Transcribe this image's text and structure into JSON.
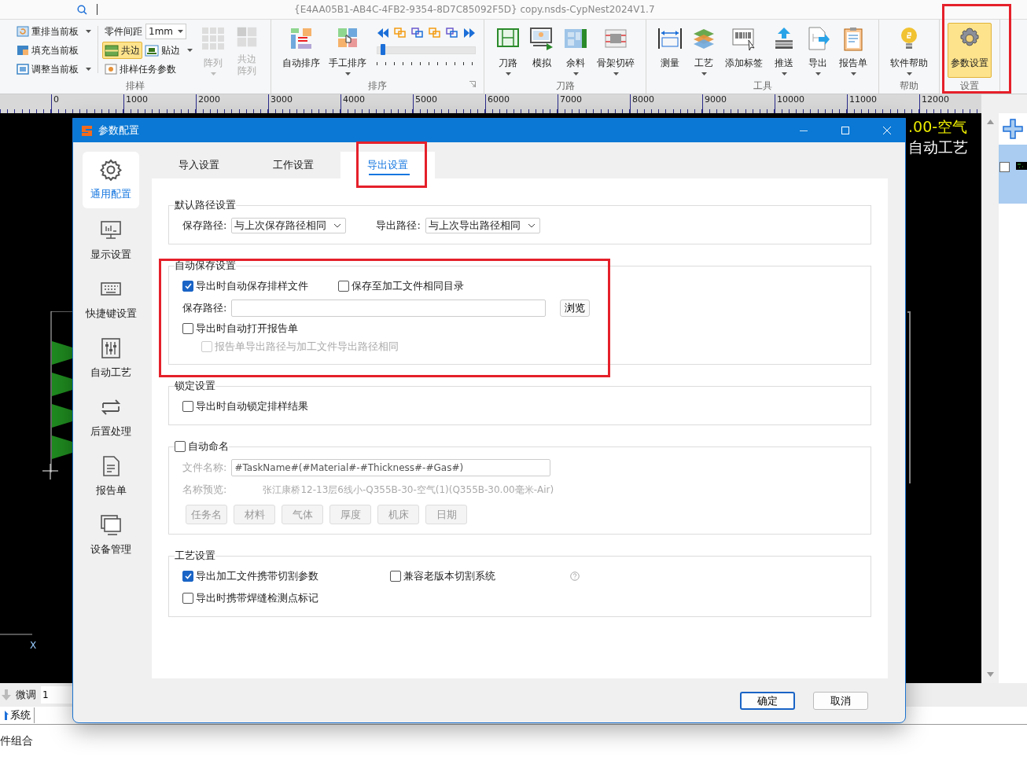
{
  "title_bar": {
    "title": "{E4AA05B1-AB4C-4FB2-9354-8D7C85092F5D} copy.nsds-CypNest2024V1.7"
  },
  "ribbon": {
    "groups": [
      {
        "kind": "nest",
        "label": "排样",
        "column_1": [
          {
            "label": "重排当前板",
            "dropdown": true
          },
          {
            "label": "填充当前板",
            "dropdown": false
          },
          {
            "label": "调整当前板",
            "dropdown": true
          }
        ],
        "spacing": {
          "label": "零件间距",
          "value": "1mm"
        },
        "edge_buttons": [
          {
            "label": "共边",
            "selected": true,
            "dropdown": false
          },
          {
            "label": "贴边",
            "selected": false,
            "dropdown": true
          }
        ],
        "task_params": {
          "label": "排样任务参数"
        },
        "buttons": [
          {
            "label": "阵列",
            "dropdown": true,
            "selected": false,
            "disabled": true
          },
          {
            "label": "共边阵列",
            "dropdown": false,
            "selected": false,
            "disabled": true
          }
        ]
      },
      {
        "kind": "sort",
        "label": "排序",
        "buttons": [
          {
            "label": "自动排序",
            "dropdown": false,
            "selected": false,
            "disabled": false
          },
          {
            "label": "手工排序",
            "dropdown": true,
            "selected": false,
            "disabled": false
          }
        ],
        "slider": {
          "level": 0.03
        }
      },
      {
        "kind": "large",
        "label": "刀路",
        "buttons": [
          {
            "label": "刀路",
            "dropdown": true,
            "selected": false,
            "disabled": false
          },
          {
            "label": "模拟",
            "dropdown": false,
            "selected": false,
            "disabled": false
          },
          {
            "label": "余料",
            "dropdown": true,
            "selected": false,
            "disabled": false
          },
          {
            "label": "骨架切碎",
            "dropdown": true,
            "selected": false,
            "disabled": false
          }
        ]
      },
      {
        "kind": "large",
        "label": "工具",
        "buttons": [
          {
            "label": "测量",
            "dropdown": false,
            "selected": false,
            "disabled": false
          },
          {
            "label": "工艺",
            "dropdown": true,
            "selected": false,
            "disabled": false
          },
          {
            "label": "添加标签",
            "dropdown": false,
            "selected": false,
            "disabled": false
          },
          {
            "label": "推送",
            "dropdown": true,
            "selected": false,
            "disabled": false
          },
          {
            "label": "导出",
            "dropdown": true,
            "selected": false,
            "disabled": false
          },
          {
            "label": "报告单",
            "dropdown": true,
            "selected": false,
            "disabled": false
          }
        ]
      },
      {
        "kind": "large",
        "label": "帮助",
        "buttons": [
          {
            "label": "软件帮助",
            "dropdown": true,
            "selected": false,
            "disabled": false
          }
        ]
      },
      {
        "kind": "large",
        "label": "设置",
        "buttons": [
          {
            "label": "参数设置",
            "dropdown": false,
            "selected": true,
            "disabled": false
          }
        ]
      }
    ]
  },
  "ruler": {
    "labels": [
      "0",
      "1000",
      "2000",
      "3000",
      "4000",
      "5000",
      "6000",
      "7000",
      "8000",
      "9000",
      "10000",
      "11000",
      "12000"
    ]
  },
  "canvas": {
    "texts": [
      {
        "text": ".00-空气",
        "color": "#f0f000"
      },
      {
        "text": "自动工艺",
        "color": "#ffffff"
      }
    ],
    "axis_label": "X"
  },
  "side_panel": {
    "items": [
      {
        "checked": false,
        "selected": true
      }
    ]
  },
  "bottom": {
    "fine_tune": {
      "label": "微调",
      "value": "1"
    },
    "tabs": [
      {
        "label": "系统"
      }
    ],
    "list": [
      "件组合"
    ]
  },
  "dialog": {
    "title": "参数配置",
    "nav": [
      {
        "label": "通用配置",
        "selected": true
      },
      {
        "label": "显示设置",
        "selected": false
      },
      {
        "label": "快捷键设置",
        "selected": false
      },
      {
        "label": "自动工艺",
        "selected": false
      },
      {
        "label": "后置处理",
        "selected": false
      },
      {
        "label": "报告单",
        "selected": false
      },
      {
        "label": "设备管理",
        "selected": false
      }
    ],
    "tabs": [
      {
        "label": "导入设置",
        "selected": false
      },
      {
        "label": "工作设置",
        "selected": false
      },
      {
        "label": "导出设置",
        "selected": true
      }
    ],
    "sections": [
      {
        "kind": "plain",
        "title": "默认路径设置",
        "disabled": false,
        "rows": [
          [
            {
              "kind": "select",
              "label": "保存路径:",
              "value": "与上次保存路径相同"
            },
            {
              "kind": "select",
              "label": "导出路径:",
              "value": "与上次导出路径相同"
            }
          ]
        ]
      },
      {
        "kind": "plain",
        "title": "自动保存设置",
        "disabled": false,
        "rows": [
          [
            {
              "kind": "checkbox",
              "label": "导出时自动保存排样文件",
              "checked": true,
              "disabled": false
            },
            {
              "kind": "checkbox",
              "label": "保存至加工文件相同目录",
              "checked": false,
              "disabled": false
            }
          ],
          [
            {
              "kind": "path",
              "label": "保存路径:",
              "button": "浏览"
            }
          ],
          [
            {
              "kind": "checkbox",
              "label": "导出时自动打开报告单",
              "checked": false,
              "disabled": false,
              "children": [
                {
                  "kind": "checkbox",
                  "label": "报告单导出路径与加工文件导出路径相同",
                  "checked": false,
                  "disabled": true
                }
              ]
            }
          ]
        ]
      },
      {
        "kind": "plain",
        "title": "锁定设置",
        "disabled": false,
        "rows": [
          [
            {
              "kind": "checkbox",
              "label": "导出时自动锁定排样结果",
              "checked": false,
              "disabled": false
            }
          ]
        ]
      },
      {
        "kind": "checkable",
        "title": "自动命名",
        "checked": false,
        "disabled": true,
        "rows": [
          [
            {
              "kind": "field",
              "label": "文件名称:",
              "value": "#TaskName#(#Material#-#Thickness#-#Gas#)"
            }
          ],
          [
            {
              "kind": "preview",
              "label": "名称预览:",
              "value": "张江康桥12-13层6线小-Q355B-30-空气(1)(Q355B-30.00毫米-Air)"
            }
          ],
          [
            {
              "kind": "tags",
              "tags": [
                "任务名",
                "材料",
                "气体",
                "厚度",
                "机床",
                "日期"
              ]
            }
          ]
        ]
      },
      {
        "kind": "plain",
        "title": "工艺设置",
        "disabled": false,
        "rows": [
          [
            {
              "kind": "checkbox",
              "label": "导出加工文件携带切割参数",
              "checked": true,
              "disabled": false
            },
            {
              "kind": "checkbox",
              "label": "兼容老版本切割系统",
              "checked": false,
              "disabled": false
            },
            {
              "kind": "help"
            }
          ],
          [
            {
              "kind": "checkbox",
              "label": "导出时携带焊缝检测点标记",
              "checked": false,
              "disabled": false
            }
          ]
        ]
      }
    ],
    "buttons": [
      {
        "label": "确定",
        "default": true
      },
      {
        "label": "取消",
        "default": false
      }
    ]
  }
}
